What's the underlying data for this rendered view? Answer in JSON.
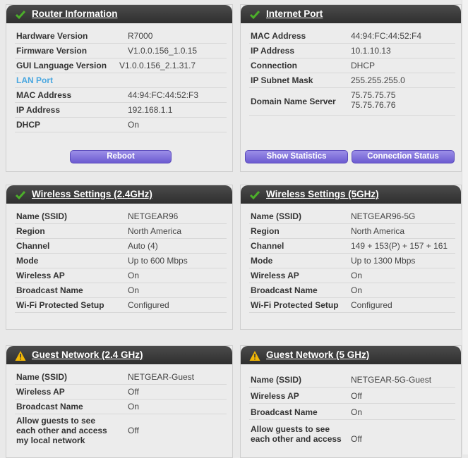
{
  "router_info": {
    "title": "Router Information",
    "rows": [
      {
        "label": "Hardware Version",
        "value": "R7000"
      },
      {
        "label": "Firmware Version",
        "value": "V1.0.0.156_1.0.15"
      },
      {
        "label": "GUI Language Version",
        "value": "V1.0.0.156_2.1.31.7"
      },
      {
        "label": "LAN Port",
        "value": ""
      },
      {
        "label": "MAC Address",
        "value": "44:94:FC:44:52:F3"
      },
      {
        "label": "IP Address",
        "value": "192.168.1.1"
      },
      {
        "label": "DHCP",
        "value": "On"
      }
    ],
    "reboot_label": "Reboot"
  },
  "internet_port": {
    "title": "Internet Port",
    "rows": [
      {
        "label": "MAC Address",
        "value": "44:94:FC:44:52:F4"
      },
      {
        "label": "IP Address",
        "value": "10.1.10.13"
      },
      {
        "label": "Connection",
        "value": "DHCP"
      },
      {
        "label": "IP Subnet Mask",
        "value": "255.255.255.0"
      },
      {
        "label": "Domain Name Server",
        "value": "75.75.75.75",
        "value2": "75.75.76.76"
      }
    ],
    "show_statistics_label": "Show Statistics",
    "connection_status_label": "Connection Status"
  },
  "wireless_24": {
    "title": "Wireless Settings (2.4GHz)",
    "rows": [
      {
        "label": "Name (SSID)",
        "value": "NETGEAR96"
      },
      {
        "label": "Region",
        "value": "North America"
      },
      {
        "label": "Channel",
        "value": "Auto (4)"
      },
      {
        "label": "Mode",
        "value": "Up to 600 Mbps"
      },
      {
        "label": "Wireless AP",
        "value": "On"
      },
      {
        "label": "Broadcast Name",
        "value": "On"
      },
      {
        "label": "Wi-Fi Protected Setup",
        "value": "Configured"
      }
    ]
  },
  "wireless_5": {
    "title": "Wireless Settings (5GHz)",
    "rows": [
      {
        "label": "Name (SSID)",
        "value": "NETGEAR96-5G"
      },
      {
        "label": "Region",
        "value": "North America"
      },
      {
        "label": "Channel",
        "value": "149 + 153(P) + 157 + 161"
      },
      {
        "label": "Mode",
        "value": "Up to 1300 Mbps"
      },
      {
        "label": "Wireless AP",
        "value": "On"
      },
      {
        "label": "Broadcast Name",
        "value": "On"
      },
      {
        "label": "Wi-Fi Protected Setup",
        "value": "Configured"
      }
    ]
  },
  "guest_24": {
    "title": "Guest Network (2.4 GHz)",
    "rows": [
      {
        "label": "Name (SSID)",
        "value": "NETGEAR-Guest"
      },
      {
        "label": "Wireless AP",
        "value": "Off"
      },
      {
        "label": "Broadcast Name",
        "value": "On"
      },
      {
        "label_lines": [
          "Allow guests to see",
          "each other and access",
          "my local network"
        ],
        "value": "Off"
      }
    ]
  },
  "guest_5": {
    "title": "Guest Network (5 GHz)",
    "rows": [
      {
        "label": "Name (SSID)",
        "value": "NETGEAR-5G-Guest"
      },
      {
        "label": "Wireless AP",
        "value": "Off"
      },
      {
        "label": "Broadcast Name",
        "value": "On"
      },
      {
        "label_lines": [
          "Allow guests to see",
          "each other and access"
        ],
        "value": "Off"
      }
    ]
  },
  "icons": {
    "ok": "check-icon",
    "warn": "warning-icon"
  },
  "colors": {
    "header": "#3a3a3a",
    "button": "#7b6ad8",
    "section_label": "#4aa7e0",
    "check": "#4caf2a",
    "warn": "#f2b705"
  }
}
